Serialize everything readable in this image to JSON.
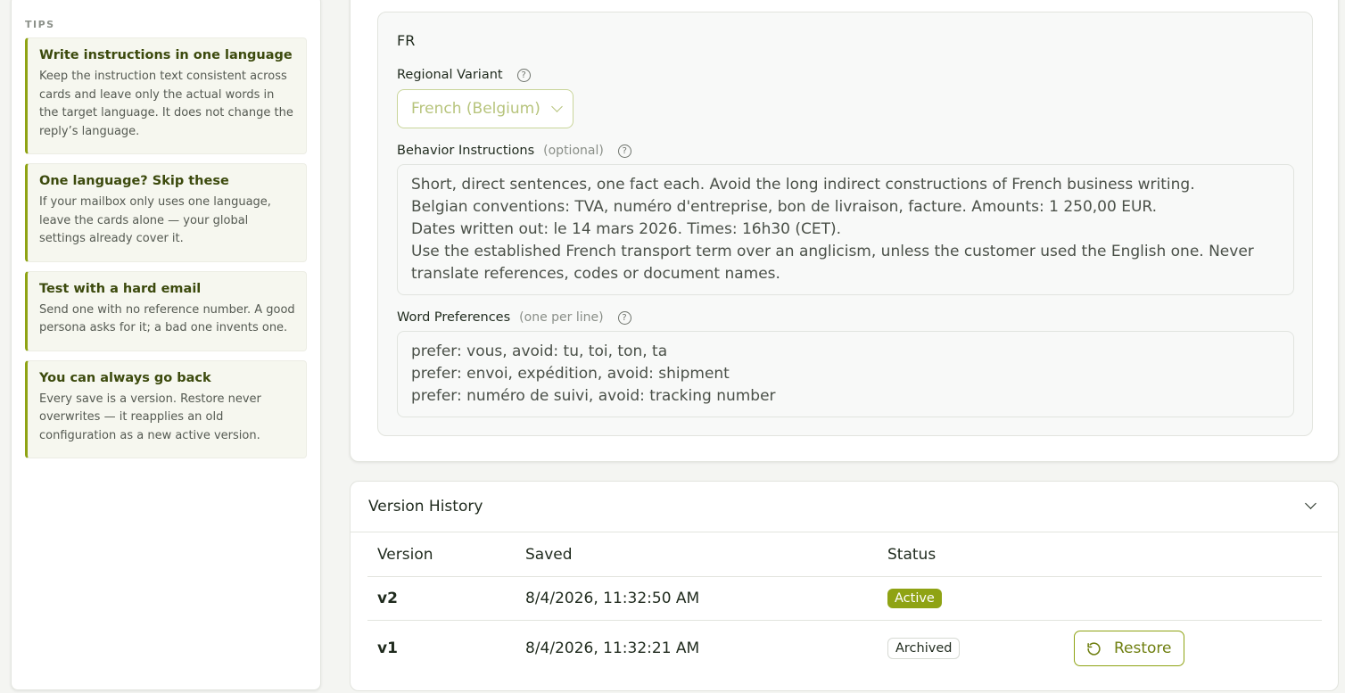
{
  "sidebar": {
    "tips_heading": "TIPS",
    "tips": [
      {
        "title": "Write instructions in one language",
        "body": "Keep the instruction text consistent across cards and leave only the actual words in the target language. It does not change the reply’s language."
      },
      {
        "title": "One language? Skip these",
        "body": "If your mailbox only uses one language, leave the cards alone — your global settings already cover it."
      },
      {
        "title": "Test with a hard email",
        "body": "Send one with no reference number. A good persona asks for it; a bad one invents one."
      },
      {
        "title": "You can always go back",
        "body": "Every save is a version. Restore never overwrites — it reapplies an old configuration as a new active version."
      }
    ]
  },
  "language_card": {
    "code": "FR",
    "regional_variant_label": "Regional Variant",
    "regional_variant_value": "French (Belgium)",
    "behavior_label": "Behavior Instructions",
    "behavior_optional": "(optional)",
    "behavior_lines": [
      "Short, direct sentences, one fact each. Avoid the long indirect constructions of French business writing.",
      "Belgian conventions: TVA, numéro d'entreprise, bon de livraison, facture. Amounts: 1 250,00 EUR.",
      "Dates written out: le 14 mars 2026. Times: 16h30 (CET).",
      "Use the established French transport term over an anglicism, unless the customer used the English one. Never",
      "translate references, codes or document names."
    ],
    "word_pref_label": "Word Preferences",
    "word_pref_hint": "(one per line)",
    "word_pref_lines": [
      "prefer: vous, avoid: tu, toi, ton, ta",
      "prefer: envoi, expédition, avoid: shipment",
      "prefer: numéro de suivi, avoid: tracking number"
    ],
    "help_glyph": "?"
  },
  "version_history": {
    "title": "Version History",
    "columns": {
      "version": "Version",
      "saved": "Saved",
      "status": "Status"
    },
    "rows": [
      {
        "version": "v2",
        "saved": "8/4/2026, 11:32:50 AM",
        "status": "Active"
      },
      {
        "version": "v1",
        "saved": "8/4/2026, 11:32:21 AM",
        "status": "Archived",
        "action": "Restore"
      }
    ]
  },
  "colors": {
    "accent": "#8fa314",
    "tip_title": "#3c4a0d",
    "select_text": "#b7c47c"
  }
}
